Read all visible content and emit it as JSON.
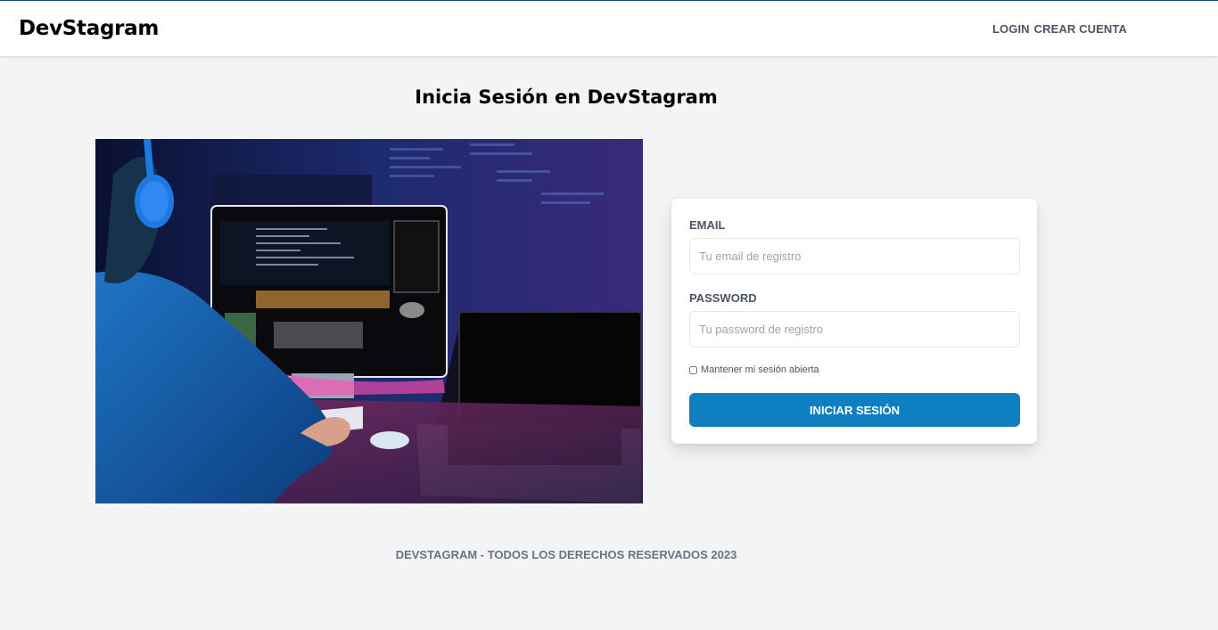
{
  "header": {
    "brand": "DevStagram",
    "nav": {
      "login": "LOGIN",
      "register": "CREAR CUENTA"
    }
  },
  "page": {
    "title": "Inicia Sesión en DevStagram"
  },
  "hero_image": {
    "description_icon": "developer-at-computer-image"
  },
  "form": {
    "email_label": "EMAIL",
    "email_placeholder": "Tu email de registro",
    "email_value": "",
    "password_label": "PASSWORD",
    "password_placeholder": "Tu password de registro",
    "password_value": "",
    "remember_label": "Mantener mi sesión abierta",
    "remember_checked": false,
    "submit_label": "INICIAR SESIÓN"
  },
  "footer": {
    "text": "DevStagram - Todos los derechos reservados 2023"
  },
  "colors": {
    "accent": "#0e80c2",
    "background": "#f3f4f6",
    "text_muted": "#4b5563"
  }
}
